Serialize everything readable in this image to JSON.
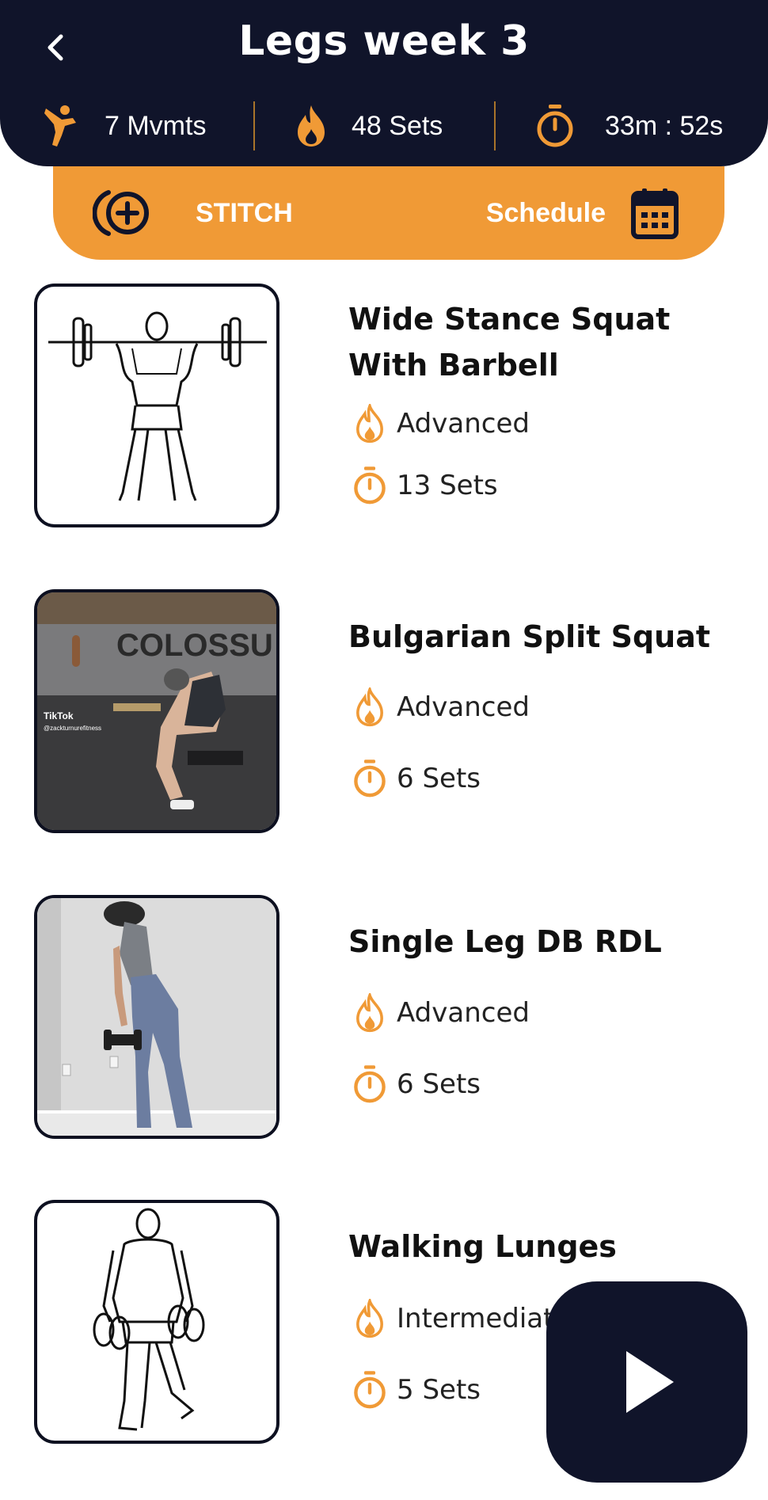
{
  "header": {
    "title": "Legs week 3",
    "stats": {
      "movements": "7 Mvmts",
      "sets": "48 Sets",
      "duration": "33m : 52s"
    }
  },
  "actions": {
    "stitch_label": "STITCH",
    "schedule_label": "Schedule"
  },
  "exercises": [
    {
      "name": "Wide Stance Squat With Barbell",
      "level": "Advanced",
      "sets": "13 Sets",
      "thumb": "barbell-squat-illustration"
    },
    {
      "name": "Bulgarian Split Squat",
      "level": "Advanced",
      "sets": "6 Sets",
      "thumb": "video-photo",
      "watermark": "TikTok",
      "watermark_user": "@zackturnurefitness"
    },
    {
      "name": "Single Leg DB RDL",
      "level": "Advanced",
      "sets": "6 Sets",
      "thumb": "video-photo"
    },
    {
      "name": "Walking Lunges",
      "level": "Intermediate",
      "sets": "5 Sets",
      "thumb": "dumbbell-lunge-illustration"
    }
  ],
  "colors": {
    "navy": "#10142a",
    "orange": "#f09a36"
  },
  "icons": [
    "back-chevron-icon",
    "kick-icon",
    "flame-icon",
    "stopwatch-icon",
    "stitch-plus-icon",
    "calendar-icon",
    "play-icon"
  ]
}
